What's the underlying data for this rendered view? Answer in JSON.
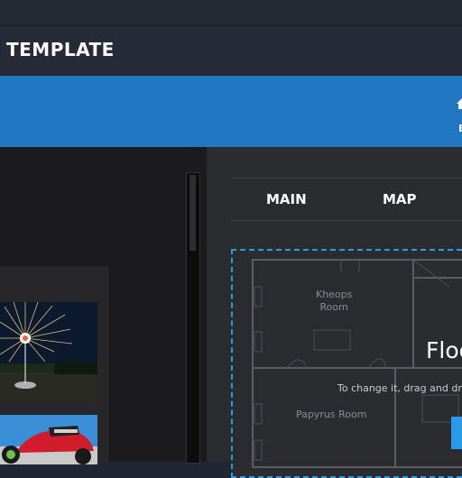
{
  "header": {
    "title": "TEMPLATE"
  },
  "toolbar": {
    "home_label": "E"
  },
  "tabs": [
    {
      "label": "MAIN"
    },
    {
      "label": "MAP"
    }
  ],
  "floorplan": {
    "title": "Floo",
    "hint": "To change it, drag and drop",
    "rooms": [
      {
        "line1": "Kheops",
        "line2": "Room"
      },
      {
        "line1": "Papyrus Room"
      }
    ]
  },
  "colors": {
    "accent_blue": "#2277c3",
    "dropzone_border": "#2a9be8",
    "background": "#222632"
  }
}
